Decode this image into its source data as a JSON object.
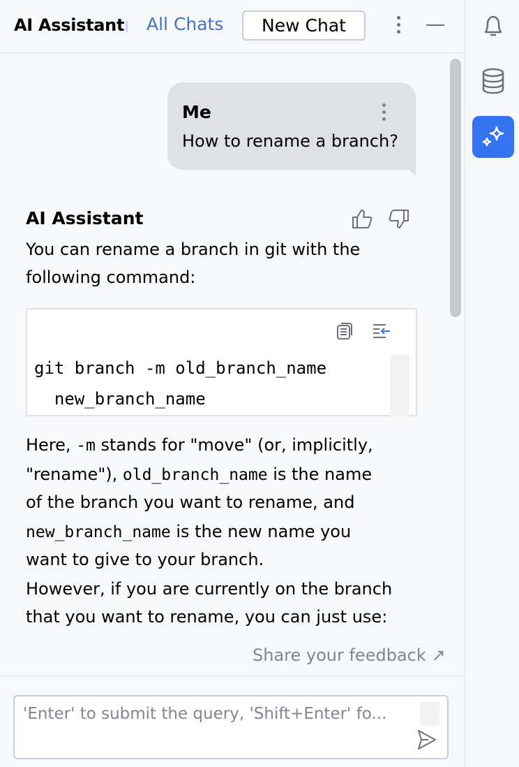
{
  "header": {
    "title": "AI Assistant",
    "all_chats_label": "All Chats",
    "new_chat_label": "New Chat",
    "more_icon": "more-vertical-icon",
    "minimize_icon": "minimize-icon"
  },
  "conversation": {
    "user_message": {
      "author": "Me",
      "text": "How to rename a branch?"
    },
    "assistant_message": {
      "author": "AI Assistant",
      "intro_lines": [
        "You can rename a branch in git with the",
        "following command:"
      ],
      "code": {
        "lines": [
          "git branch -m old_branch_name",
          "  new_branch_name"
        ],
        "copy_icon": "copy-icon",
        "insert_icon": "insert-at-caret-icon"
      },
      "explanation": {
        "l1_a": "Here, ",
        "l1_code": "-m",
        "l1_b": " stands for \"move\" (or, implicitly,",
        "l2_a": "\"rename\"), ",
        "l2_code": "old_branch_name",
        "l2_b": " is the name",
        "l3": "of the branch you want to rename, and",
        "l4_code": "new_branch_name",
        "l4_b": " is the new name you",
        "l5": "want to give to your branch.",
        "l6": "However, if you are currently on the branch",
        "l7": "that you want to rename, you can just use:"
      }
    },
    "feedback_link": "Share your feedback ↗"
  },
  "input": {
    "placeholder": "'Enter' to submit the query, 'Shift+Enter' fo...",
    "value": ""
  },
  "right_rail": {
    "items": [
      {
        "name": "notifications",
        "icon": "bell-icon",
        "active": false
      },
      {
        "name": "database",
        "icon": "database-icon",
        "active": false
      },
      {
        "name": "ai-assistant",
        "icon": "sparkle-icon",
        "active": true
      }
    ],
    "accent_color": "#3574f0"
  }
}
